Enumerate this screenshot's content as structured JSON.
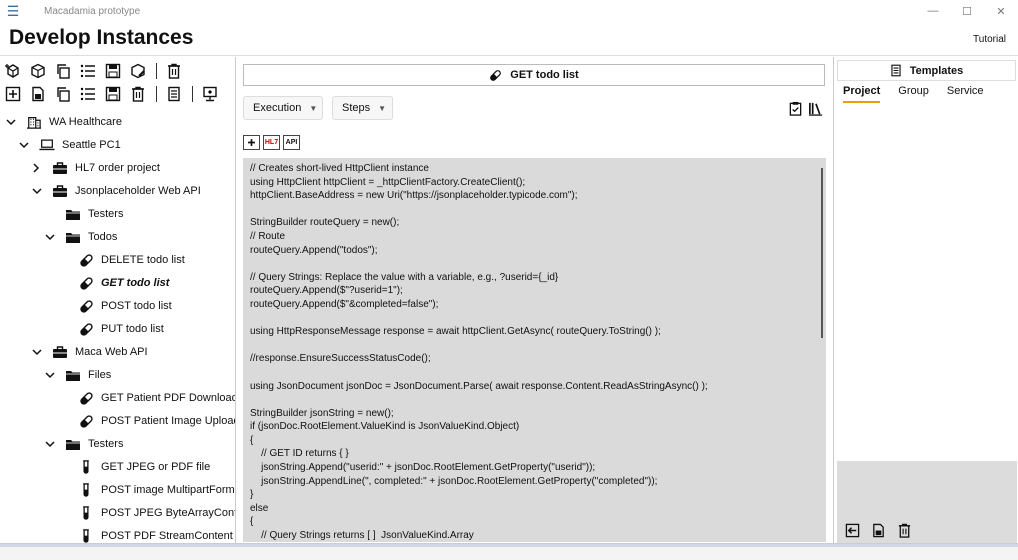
{
  "window": {
    "title": "Macadamia prototype",
    "controls": [
      "—",
      "☐",
      "✕"
    ]
  },
  "header": {
    "title": "Develop Instances",
    "tutorial_label": "Tutorial"
  },
  "left_toolbar": {
    "row1": [
      "add-package-icon",
      "package-icon",
      "copy-icon",
      "list-icon",
      "save-icon",
      "edit-package-icon",
      "delete-icon"
    ],
    "row2": [
      "add-icon",
      "file-icon",
      "copy-icon",
      "list-icon",
      "save-icon",
      "delete-icon",
      "document-icon",
      "monitor-icon"
    ]
  },
  "tree": [
    {
      "label": "WA Healthcare",
      "level": 0,
      "chev": "v",
      "icon": "building"
    },
    {
      "label": "Seattle PC1",
      "level": 1,
      "chev": "v",
      "icon": "laptop"
    },
    {
      "label": "HL7 order project",
      "level": 2,
      "chev": ">",
      "icon": "briefcase"
    },
    {
      "label": "Jsonplaceholder Web API",
      "level": 2,
      "chev": "v",
      "icon": "briefcase"
    },
    {
      "label": "Testers",
      "level": 3,
      "chev": "",
      "icon": "folder"
    },
    {
      "label": "Todos",
      "level": 3,
      "chev": "v",
      "icon": "folder"
    },
    {
      "label": "DELETE todo list",
      "level": 4,
      "chev": "",
      "icon": "pill"
    },
    {
      "label": "GET todo list",
      "level": 4,
      "chev": "",
      "icon": "pill",
      "selected": true
    },
    {
      "label": "POST todo list",
      "level": 4,
      "chev": "",
      "icon": "pill"
    },
    {
      "label": "PUT todo list",
      "level": 4,
      "chev": "",
      "icon": "pill"
    },
    {
      "label": "Maca Web API",
      "level": 2,
      "chev": "v",
      "icon": "briefcase"
    },
    {
      "label": "Files",
      "level": 3,
      "chev": "v",
      "icon": "folder"
    },
    {
      "label": "GET Patient PDF Downloader",
      "level": 4,
      "chev": "",
      "icon": "pill"
    },
    {
      "label": "POST Patient Image Uploader",
      "level": 4,
      "chev": "",
      "icon": "pill"
    },
    {
      "label": "Testers",
      "level": 3,
      "chev": "v",
      "icon": "folder"
    },
    {
      "label": "GET JPEG or PDF file",
      "level": 4,
      "chev": "",
      "icon": "tube"
    },
    {
      "label": "POST image MultipartFormDa",
      "level": 4,
      "chev": "",
      "icon": "tube"
    },
    {
      "label": "POST JPEG ByteArrayContent",
      "level": 4,
      "chev": "",
      "icon": "tube"
    },
    {
      "label": "POST PDF StreamContent",
      "level": 4,
      "chev": "",
      "icon": "tube"
    }
  ],
  "center": {
    "request_title": "GET todo list",
    "execution_label": "Execution",
    "steps_label": "Steps",
    "format_buttons": [
      "",
      "HL7",
      "API"
    ],
    "code": "// Creates short-lived HttpClient instance\nusing HttpClient httpClient = _httpClientFactory.CreateClient();\nhttpClient.BaseAddress = new Uri(\"https://jsonplaceholder.typicode.com\");\n\nStringBuilder routeQuery = new();\n// Route\nrouteQuery.Append(\"todos\");\n\n// Query Strings: Replace the value with a variable, e.g., ?userid={_id}\nrouteQuery.Append($\"?userid=1\");\nrouteQuery.Append($\"&completed=false\");\n\nusing HttpResponseMessage response = await httpClient.GetAsync( routeQuery.ToString() );\n\n//response.EnsureSuccessStatusCode();\n\nusing JsonDocument jsonDoc = JsonDocument.Parse( await response.Content.ReadAsStringAsync() );\n\nStringBuilder jsonString = new();\nif (jsonDoc.RootElement.ValueKind is JsonValueKind.Object)\n{\n    // GET ID returns { }\n    jsonString.Append(\"userid:\" + jsonDoc.RootElement.GetProperty(\"userid\"));\n    jsonString.AppendLine(\", completed:\" + jsonDoc.RootElement.GetProperty(\"completed\"));\n}\nelse\n{\n    // Query Strings returns [ ]  JsonValueKind.Array"
  },
  "templates": {
    "title": "Templates",
    "tabs": [
      {
        "label": "Project",
        "active": true
      },
      {
        "label": "Group"
      },
      {
        "label": "Service"
      }
    ]
  },
  "colors": {
    "accent": "#e8a000",
    "editor_bg": "#dadada",
    "menu": "#3a6ea5"
  }
}
